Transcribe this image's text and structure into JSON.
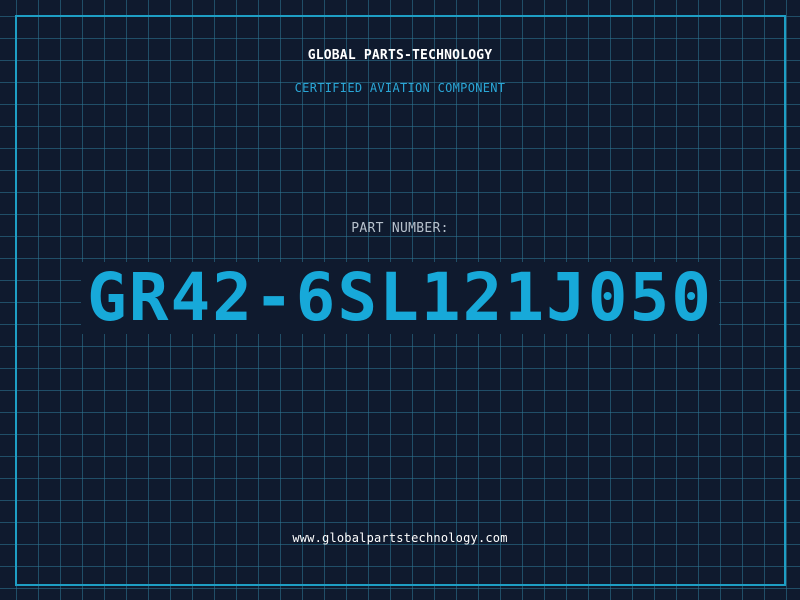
{
  "header": {
    "brand": "GLOBAL PARTS-TECHNOLOGY",
    "tagline": "CERTIFIED AVIATION COMPONENT"
  },
  "part": {
    "label": "PART NUMBER:",
    "number": "GR42-6SL121J050"
  },
  "footer": {
    "url": "www.globalpartstechnology.com"
  },
  "colors": {
    "background": "#0f1a2e",
    "grid": "#2d7896",
    "frame": "#1e9ec4",
    "accent": "#17a9d9",
    "tagline": "#2aa6d6",
    "label": "#b7c1cc",
    "text": "#ffffff"
  }
}
